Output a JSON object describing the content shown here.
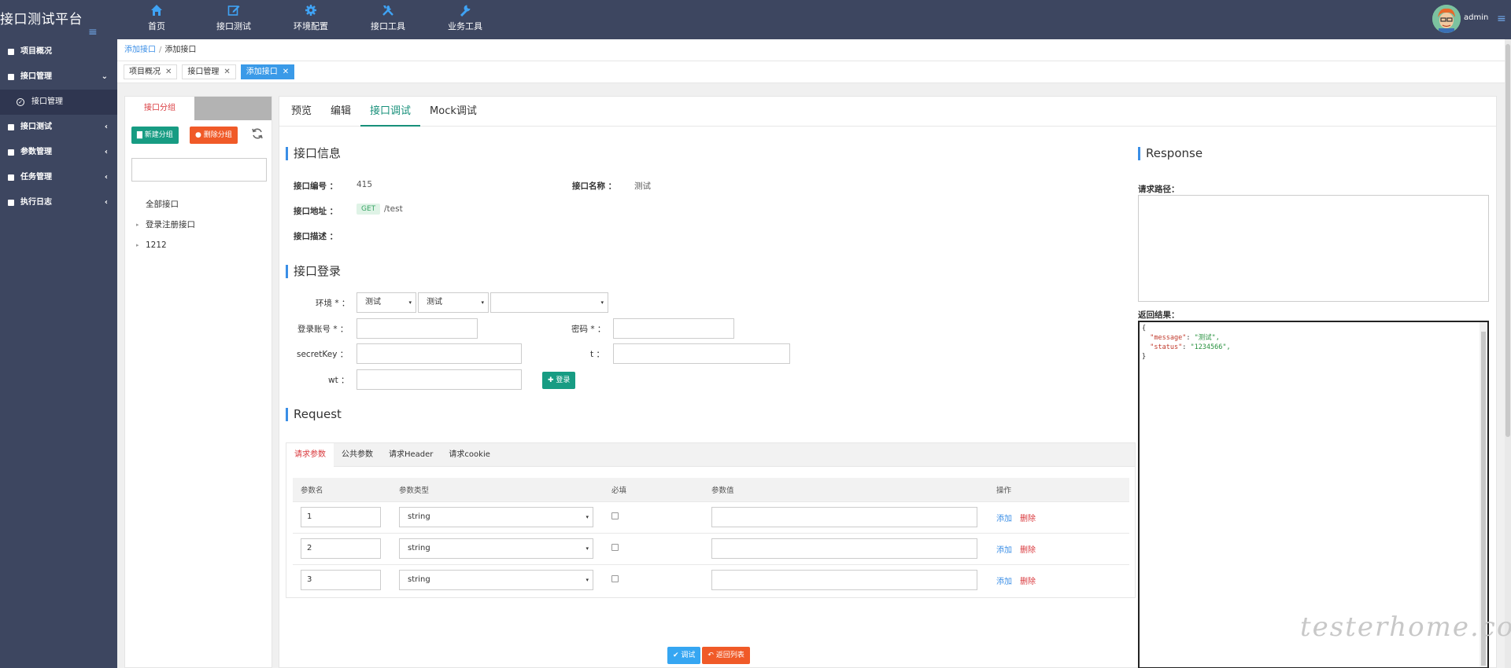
{
  "app": {
    "title": "接口测试平台",
    "menu_toggle": "≡"
  },
  "topnav": [
    {
      "label": "首页",
      "icon": "home-icon"
    },
    {
      "label": "接口测试",
      "icon": "edit-icon"
    },
    {
      "label": "环境配置",
      "icon": "gear-icon"
    },
    {
      "label": "接口工具",
      "icon": "tools-icon"
    },
    {
      "label": "业务工具",
      "icon": "wrench-icon"
    }
  ],
  "user": {
    "name": "admin",
    "menu_toggle": "≡"
  },
  "sidebar": {
    "items": [
      {
        "label": "项目概况",
        "arrow": ""
      },
      {
        "label": "接口管理",
        "arrow": "⌄"
      },
      {
        "label": "接口管理",
        "sub": true
      },
      {
        "label": "接口测试",
        "arrow": "‹"
      },
      {
        "label": "参数管理",
        "arrow": "‹"
      },
      {
        "label": "任务管理",
        "arrow": "‹"
      },
      {
        "label": "执行日志",
        "arrow": "‹"
      }
    ]
  },
  "breadcrumb": {
    "link": "添加接口",
    "sep": "/",
    "current": "添加接口"
  },
  "page_tabs": [
    {
      "label": "项目概况",
      "close": "✕"
    },
    {
      "label": "接口管理",
      "close": "✕"
    },
    {
      "label": "添加接口",
      "close": "✕",
      "active": true
    }
  ],
  "groups": {
    "tab_label": "接口分组",
    "new_button": "新建分组",
    "delete_button": "删除分组",
    "search_placeholder": "",
    "tree": [
      {
        "label": "全部接口",
        "expandable": false
      },
      {
        "label": "登录注册接口",
        "expandable": true
      },
      {
        "label": "1212",
        "expandable": true
      }
    ],
    "tree_caret": "▸"
  },
  "main_tabs": [
    {
      "label": "预览"
    },
    {
      "label": "编辑"
    },
    {
      "label": "接口调试",
      "active": true
    },
    {
      "label": "Mock调试"
    }
  ],
  "info": {
    "section_title": "接口信息",
    "id_label": "接口编号 ：",
    "id_value": "415",
    "name_label": "接口名称 ：",
    "name_value": "测试",
    "url_label": "接口地址 ：",
    "method": "GET",
    "path": "/test",
    "desc_label": "接口描述 ："
  },
  "login": {
    "section_title": "接口登录",
    "env_label": "环境 * ：",
    "env_select_1": "测试",
    "env_select_2": "测试",
    "env_select_3": "",
    "account_label": "登录账号 * ：",
    "account_value": "",
    "password_label": "密码 * ：",
    "password_value": "",
    "secretkey_label": "secretKey ：",
    "t_label": "t ：",
    "wt_label": "wt ：",
    "login_button": "登录",
    "caret": "▾"
  },
  "request": {
    "section_title": "Request",
    "tabs": [
      {
        "label": "请求参数",
        "active": true
      },
      {
        "label": "公共参数"
      },
      {
        "label": "请求Header"
      },
      {
        "label": "请求cookie"
      }
    ],
    "columns": [
      "参数名",
      "参数类型",
      "必填",
      "参数值",
      "操作"
    ],
    "rows": [
      {
        "name": "1",
        "type": "string",
        "required": false,
        "value": "",
        "add": "添加",
        "del": "删除"
      },
      {
        "name": "2",
        "type": "string",
        "required": false,
        "value": "",
        "add": "添加",
        "del": "删除"
      },
      {
        "name": "3",
        "type": "string",
        "required": false,
        "value": "",
        "add": "添加",
        "del": "删除"
      }
    ]
  },
  "response": {
    "section_title": "Response",
    "path_label": "请求路径：",
    "path_value": "",
    "result_label": "返回结果：",
    "json_open": "{",
    "json_close": "}",
    "fields": [
      {
        "key": "\"message\"",
        "value": "\"测试\","
      },
      {
        "key": "\"status\"",
        "value": "\"1234566\","
      }
    ]
  },
  "actions": {
    "debug_button": "调试",
    "back_button": "返回列表"
  },
  "watermark": "testerhome.com",
  "colors": {
    "header_bg": "#3d4660",
    "accent_blue": "#3a8ee6",
    "accent_green": "#179c83",
    "accent_red": "#d9383c",
    "button_orange": "#f05a28",
    "tab_active_blue": "#3a9ae8"
  }
}
